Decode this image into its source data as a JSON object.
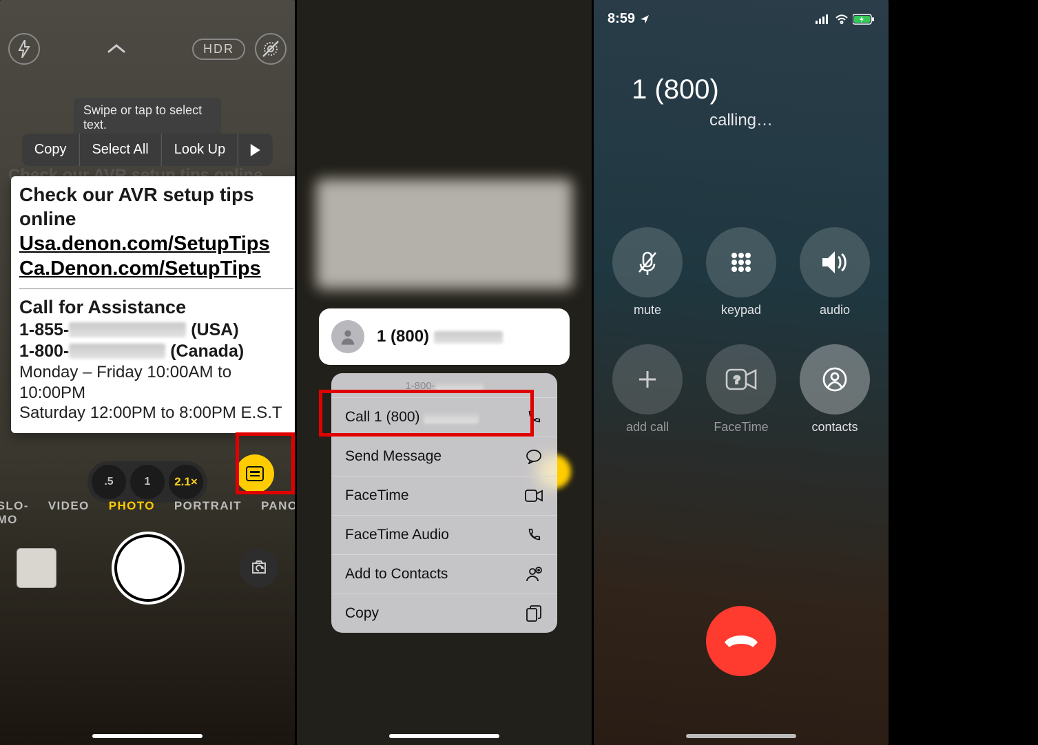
{
  "phone1": {
    "top": {
      "hdr": "HDR"
    },
    "hint": "Swipe or tap to select text.",
    "actions": {
      "copy": "Copy",
      "select_all": "Select All",
      "look_up": "Look Up"
    },
    "ghost": "Check our AVR setup tips online",
    "card": {
      "title": "Check our AVR setup tips online",
      "link_us": "Usa.denon.com/SetupTips",
      "link_ca": "Ca.Denon.com/SetupTips",
      "assist": "Call for Assistance",
      "ph_us_pre": "1-855-",
      "ph_us_suf": "(USA)",
      "ph_ca_pre": "1-800-",
      "ph_ca_suf": "(Canada)",
      "hours1": "Monday – Friday 10:00AM to 10:00PM",
      "hours2": "Saturday 12:00PM to 8:00PM E.S.T"
    },
    "zoom": {
      "a": ".5",
      "b": "1",
      "c": "2.1×"
    },
    "modes": {
      "slomo": "SLO-MO",
      "video": "VIDEO",
      "photo": "PHOTO",
      "portrait": "PORTRAIT",
      "pano": "PANO"
    }
  },
  "phone2": {
    "contact": {
      "prefix": "1 (800)",
      "menu_header": "1-800-"
    },
    "menu": {
      "call": "Call 1 (800)",
      "send_message": "Send Message",
      "facetime": "FaceTime",
      "facetime_audio": "FaceTime Audio",
      "add_contacts": "Add to Contacts",
      "copy": "Copy"
    }
  },
  "phone3": {
    "time": "8:59",
    "number_prefix": "1 (800)",
    "status": "calling…",
    "buttons": {
      "mute": "mute",
      "keypad": "keypad",
      "audio": "audio",
      "add_call": "add call",
      "facetime": "FaceTime",
      "contacts": "contacts"
    }
  }
}
